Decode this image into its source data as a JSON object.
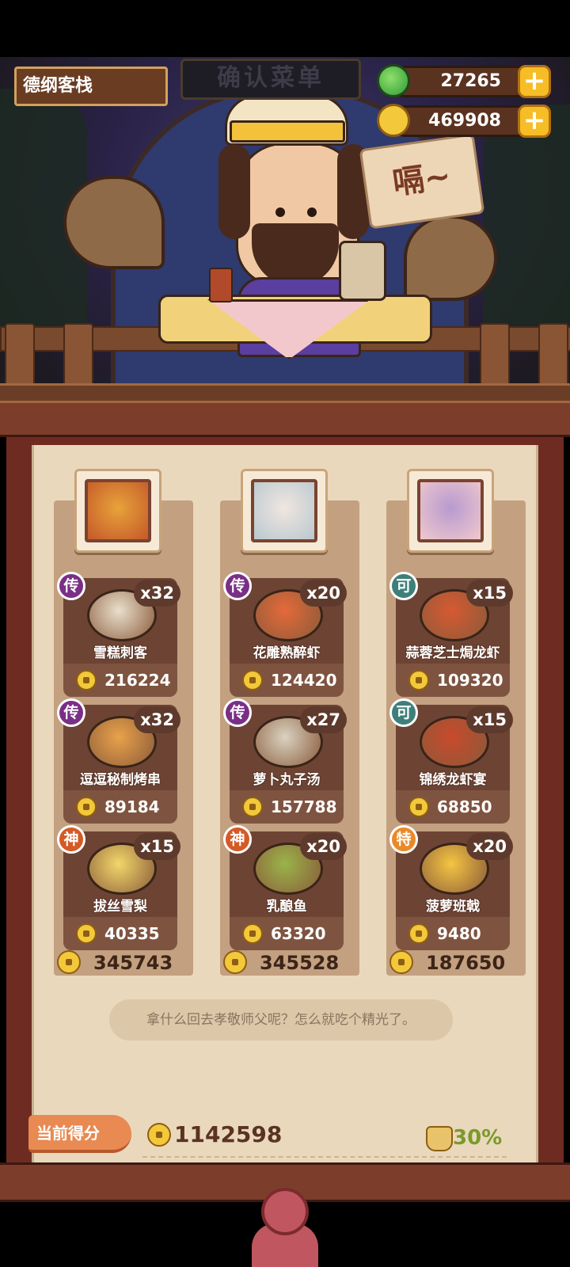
{
  "shop": {
    "name": "德纲客栈"
  },
  "sign": {
    "title": "确认菜单"
  },
  "currency": {
    "jade": {
      "value": "27265",
      "icon": "jade-icon"
    },
    "coins": {
      "value": "469908",
      "icon": "coin-icon"
    },
    "plus_label": "+"
  },
  "speech": {
    "text": "嗝~"
  },
  "columns": [
    {
      "customer": "bear",
      "total": "345743",
      "dishes": [
        {
          "badge": "传",
          "badge_color": "#7a2f86",
          "qty": "x32",
          "name": "雪糕刺客",
          "price": "216224",
          "food_color": "#e9dfcc"
        },
        {
          "badge": "传",
          "badge_color": "#7a2f86",
          "qty": "x32",
          "name": "逗逗秘制烤串",
          "price": "89184",
          "food_color": "#e9a24a"
        },
        {
          "badge": "神",
          "badge_color": "#d45a26",
          "qty": "x15",
          "name": "拔丝雪梨",
          "price": "40335",
          "food_color": "#f1d76a"
        }
      ]
    },
    {
      "customer": "white-hair",
      "total": "345528",
      "dishes": [
        {
          "badge": "传",
          "badge_color": "#7a2f86",
          "qty": "x20",
          "name": "花雕熟醉虾",
          "price": "124420",
          "food_color": "#e46a3a"
        },
        {
          "badge": "传",
          "badge_color": "#7a2f86",
          "qty": "x27",
          "name": "萝卜丸子汤",
          "price": "157788",
          "food_color": "#d9d2c0"
        },
        {
          "badge": "神",
          "badge_color": "#d45a26",
          "qty": "x20",
          "name": "乳酿鱼",
          "price": "63320",
          "food_color": "#9ab44a"
        }
      ]
    },
    {
      "customer": "purple-hair",
      "total": "187650",
      "dishes": [
        {
          "badge": "可",
          "badge_color": "#3f7f7a",
          "qty": "x15",
          "name": "蒜蓉芝士焗龙虾",
          "price": "109320",
          "food_color": "#d65a32"
        },
        {
          "badge": "可",
          "badge_color": "#3f7f7a",
          "qty": "x15",
          "name": "锦绣龙虾宴",
          "price": "68850",
          "food_color": "#c84a2c"
        },
        {
          "badge": "特",
          "badge_color": "#e88a2a",
          "qty": "x20",
          "name": "菠萝班戟",
          "price": "9480",
          "food_color": "#f4c542"
        }
      ]
    }
  ],
  "comment": "拿什么回去孝敬师父呢？怎么就吃个精光了。",
  "score": {
    "label": "当前得分",
    "value": "1142598",
    "percent": "30%"
  }
}
